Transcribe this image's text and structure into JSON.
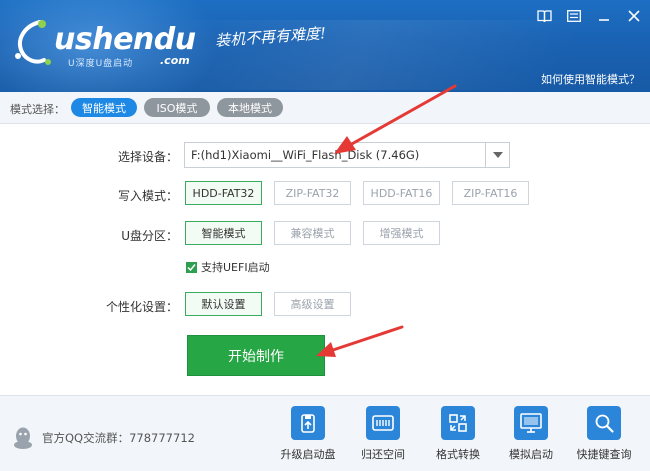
{
  "header": {
    "logo_main": "ushendu",
    "logo_sub": "U深度U盘启动",
    "logo_com": ".com",
    "slogan": "装机不再有难度!",
    "help_link": "如何使用智能模式？"
  },
  "mode_bar": {
    "label": "模式选择：",
    "tabs": [
      {
        "label": "智能模式",
        "active": true
      },
      {
        "label": "ISO模式",
        "active": false
      },
      {
        "label": "本地模式",
        "active": false
      }
    ]
  },
  "form": {
    "device_label": "选择设备：",
    "device_value": "F:(hd1)Xiaomi__WiFi_Flash_Disk (7.46G)",
    "write_label": "写入模式：",
    "write_options": [
      {
        "label": "HDD-FAT32",
        "selected": true
      },
      {
        "label": "ZIP-FAT32",
        "selected": false
      },
      {
        "label": "HDD-FAT16",
        "selected": false
      },
      {
        "label": "ZIP-FAT16",
        "selected": false
      }
    ],
    "partition_label": "U盘分区：",
    "partition_options": [
      {
        "label": "智能模式",
        "selected": true
      },
      {
        "label": "兼容模式",
        "selected": false
      },
      {
        "label": "增强模式",
        "selected": false
      }
    ],
    "uefi_label": "支持UEFI启动",
    "uefi_checked": true,
    "personal_label": "个性化设置：",
    "personal_options": [
      {
        "label": "默认设置",
        "selected": true
      },
      {
        "label": "高级设置",
        "selected": false
      }
    ],
    "start_button": "开始制作"
  },
  "footer": {
    "qq_group": "官方QQ交流群：778777712",
    "tools": [
      {
        "label": "升级启动盘",
        "icon": "upgrade-usb-icon"
      },
      {
        "label": "归还空间",
        "icon": "restore-space-icon"
      },
      {
        "label": "格式转换",
        "icon": "format-convert-icon"
      },
      {
        "label": "模拟启动",
        "icon": "simulate-boot-icon"
      },
      {
        "label": "快捷键查询",
        "icon": "hotkey-search-icon"
      }
    ]
  },
  "colors": {
    "header_blue": "#1a62b3",
    "active_tab": "#1e88e5",
    "inactive_tab": "#8e969e",
    "green": "#26a645",
    "arrow_red": "#e53935"
  }
}
